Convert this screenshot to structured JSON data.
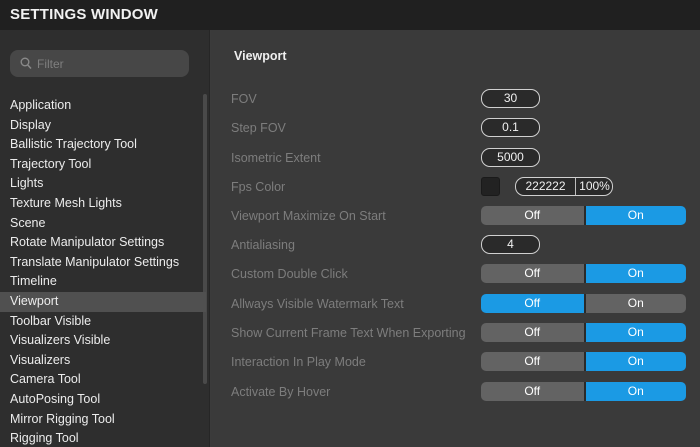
{
  "window": {
    "title": "SETTINGS WINDOW"
  },
  "sidebar": {
    "filter": {
      "placeholder": "Filter",
      "value": "",
      "icon": "search-icon"
    },
    "selected": "Viewport",
    "items": [
      "Application",
      "Display",
      "Ballistic Trajectory Tool",
      "Trajectory Tool",
      "Lights",
      "Texture Mesh Lights",
      "Scene",
      "Rotate Manipulator Settings",
      "Translate Manipulator Settings",
      "Timeline",
      "Viewport",
      "Toolbar Visible",
      "Visualizers Visible",
      "Visualizers",
      "Camera Tool",
      "AutoPosing Tool",
      "Mirror Rigging Tool",
      "Rigging Tool"
    ]
  },
  "main": {
    "section_title": "Viewport",
    "settings": {
      "fov": {
        "label": "FOV",
        "value": "30"
      },
      "step_fov": {
        "label": "Step FOV",
        "value": "0.1"
      },
      "isometric_extent": {
        "label": "Isometric Extent",
        "value": "5000"
      },
      "fps_color": {
        "label": "Fps Color",
        "hex": "222222",
        "opacity": "100%",
        "swatch": "#222222"
      },
      "viewport_maximize": {
        "label": "Viewport Maximize On Start",
        "off": "Off",
        "on": "On",
        "active": "On"
      },
      "antialiasing": {
        "label": "Antialiasing",
        "value": "4"
      },
      "custom_double_click": {
        "label": "Custom Double Click",
        "off": "Off",
        "on": "On",
        "active": "On"
      },
      "watermark_text": {
        "label": "Allways Visible Watermark Text",
        "off": "Off",
        "on": "On",
        "active": "Off"
      },
      "frame_text_exporting": {
        "label": "Show Current Frame Text When Exporting",
        "off": "Off",
        "on": "On",
        "active": "On"
      },
      "interaction_play_mode": {
        "label": "Interaction In Play Mode",
        "off": "Off",
        "on": "On",
        "active": "On"
      },
      "activate_by_hover": {
        "label": "Activate By Hover",
        "off": "Off",
        "on": "On",
        "active": "On"
      }
    }
  },
  "colors": {
    "accent": "#1b9ae4",
    "toggle_inactive": "#636363",
    "sidebar_bg": "#2e2e2e",
    "main_bg": "#3a3a3a",
    "titlebar_bg": "#202020"
  }
}
